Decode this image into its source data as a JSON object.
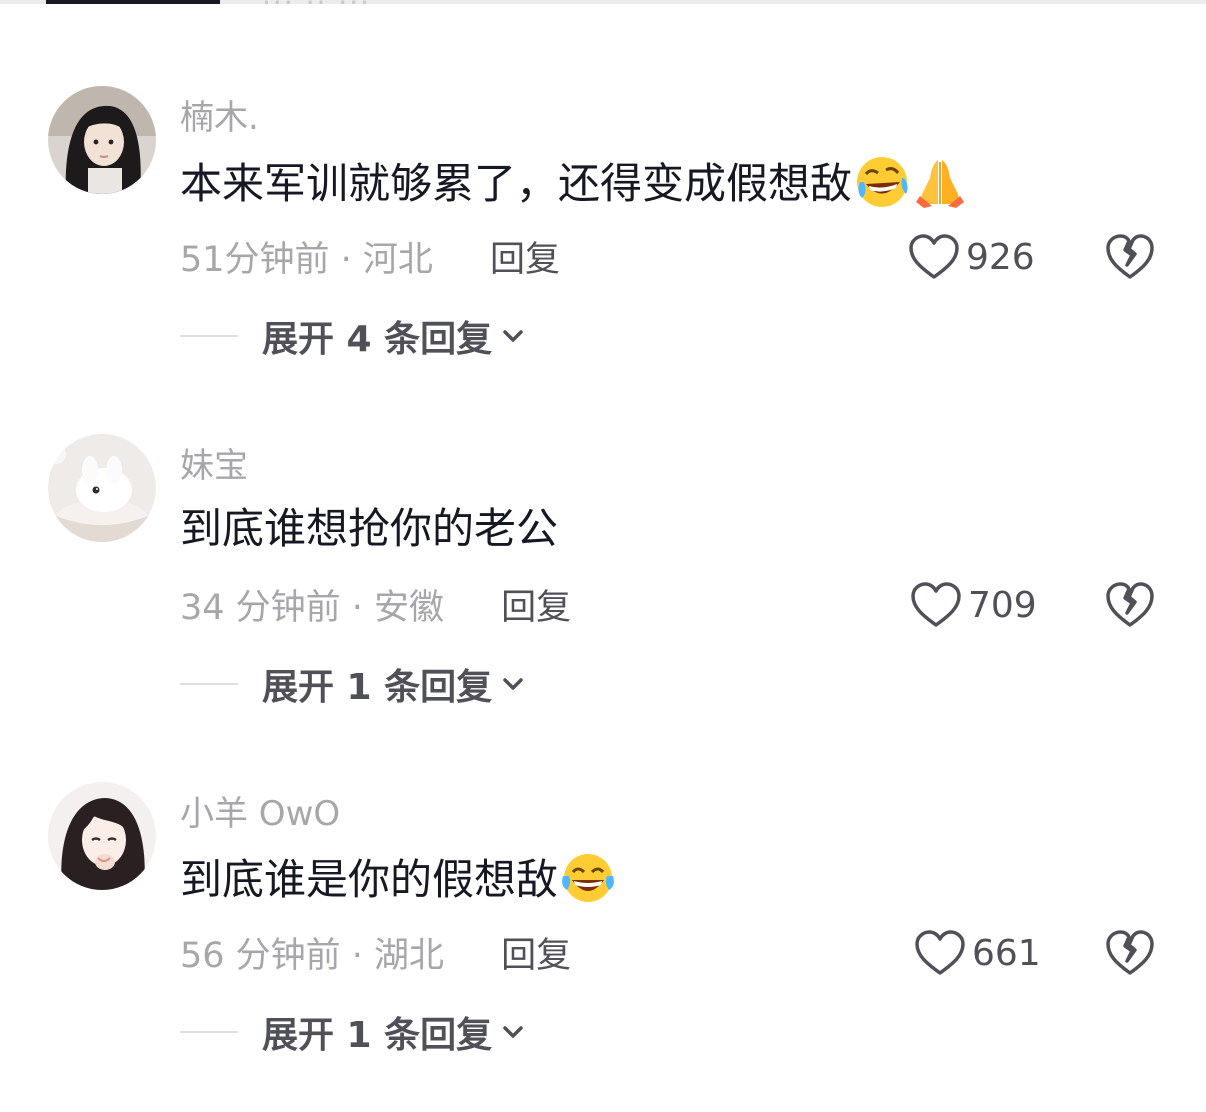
{
  "top_tab": {
    "ghost_text": "··· ·· ···"
  },
  "comments": [
    {
      "username": "楠木.",
      "text": "本来军训就够累了，还得变成假想敌",
      "emoji": [
        "rolling-laugh-emoji",
        "folded-hands-emoji"
      ],
      "time_location": "51分钟前 · 河北",
      "reply_label": "回复",
      "likes": "926",
      "expand_label": "展开 4 条回复",
      "avatar_icon": "girl-dark-hair-avatar"
    },
    {
      "username": "妹宝",
      "text": "到底谁想抢你的老公",
      "emoji": [],
      "time_location": "34 分钟前 · 安徽",
      "reply_label": "回复",
      "likes": "709",
      "expand_label": "展开 1 条回复",
      "avatar_icon": "white-bunny-avatar"
    },
    {
      "username": "小羊 OwO",
      "text": "到底谁是你的假想敌",
      "emoji": [
        "tears-of-joy-emoji"
      ],
      "time_location": "56 分钟前 · 湖北",
      "reply_label": "回复",
      "likes": "661",
      "expand_label": "展开 1 条回复",
      "avatar_icon": "girl-anime-avatar"
    }
  ],
  "colors": {
    "primary_text": "#161823",
    "secondary_text": "#a6a7ab",
    "action_text": "#505158"
  }
}
